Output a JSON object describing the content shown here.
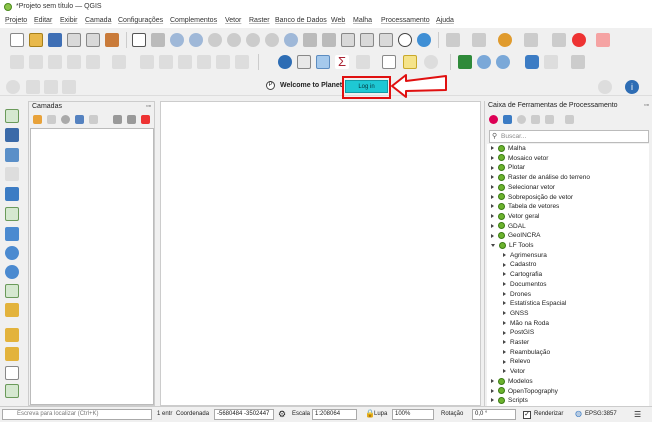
{
  "window": {
    "title": "*Projeto sem título — QGIS"
  },
  "menu": [
    "Projeto",
    "Editar",
    "Exibir",
    "Camada",
    "Configurações",
    "Complementos",
    "Vetor",
    "Raster",
    "Banco de Dados",
    "Web",
    "Malha",
    "Processamento",
    "Ajuda"
  ],
  "planet": {
    "welcome": "Welcome to Planet",
    "login_label": "Log in"
  },
  "layers_panel": {
    "title": "Camadas"
  },
  "processing": {
    "title": "Caixa de Ferramentas de Processamento",
    "search_placeholder": "Buscar...",
    "tree": [
      {
        "label": "Malha",
        "level": 0,
        "expanded": false
      },
      {
        "label": "Mosaico vetor",
        "level": 0,
        "expanded": false
      },
      {
        "label": "Plotar",
        "level": 0,
        "expanded": false
      },
      {
        "label": "Raster de análise do terreno",
        "level": 0,
        "expanded": false
      },
      {
        "label": "Selecionar vetor",
        "level": 0,
        "expanded": false
      },
      {
        "label": "Sobreposição de vetor",
        "level": 0,
        "expanded": false
      },
      {
        "label": "Tabela de vetores",
        "level": 0,
        "expanded": false
      },
      {
        "label": "Vetor geral",
        "level": 0,
        "expanded": false
      },
      {
        "label": "GDAL",
        "level": 0,
        "expanded": false
      },
      {
        "label": "GeoINCRA",
        "level": 0,
        "expanded": false
      },
      {
        "label": "LF Tools",
        "level": 0,
        "expanded": true
      },
      {
        "label": "Agrimensura",
        "level": 1,
        "expanded": false
      },
      {
        "label": "Cadastro",
        "level": 1,
        "expanded": false
      },
      {
        "label": "Cartografia",
        "level": 1,
        "expanded": false
      },
      {
        "label": "Documentos",
        "level": 1,
        "expanded": false
      },
      {
        "label": "Drones",
        "level": 1,
        "expanded": false
      },
      {
        "label": "Estatística Espacial",
        "level": 1,
        "expanded": false
      },
      {
        "label": "GNSS",
        "level": 1,
        "expanded": false
      },
      {
        "label": "Mão na Roda",
        "level": 1,
        "expanded": false
      },
      {
        "label": "PostGIS",
        "level": 1,
        "expanded": false
      },
      {
        "label": "Raster",
        "level": 1,
        "expanded": false
      },
      {
        "label": "Reambulação",
        "level": 1,
        "expanded": false
      },
      {
        "label": "Relevo",
        "level": 1,
        "expanded": false
      },
      {
        "label": "Vetor",
        "level": 1,
        "expanded": false
      },
      {
        "label": "Modelos",
        "level": 0,
        "expanded": false
      },
      {
        "label": "OpenTopography",
        "level": 0,
        "expanded": false
      },
      {
        "label": "Scripts",
        "level": 0,
        "expanded": false
      }
    ]
  },
  "status": {
    "locator_placeholder": "Escreva para localizar (Ctrl+K)",
    "msg": "1 entr",
    "coord_label": "Coordenada",
    "coord_value": "-5680484 -3502447",
    "scale_label": "Escala",
    "scale_value": "1:208064",
    "mag_label": "Lupa",
    "mag_value": "100%",
    "rot_label": "Rotação",
    "rot_value": "0,0 °",
    "render_label": "Renderizar",
    "crs": "EPSG:3857"
  }
}
